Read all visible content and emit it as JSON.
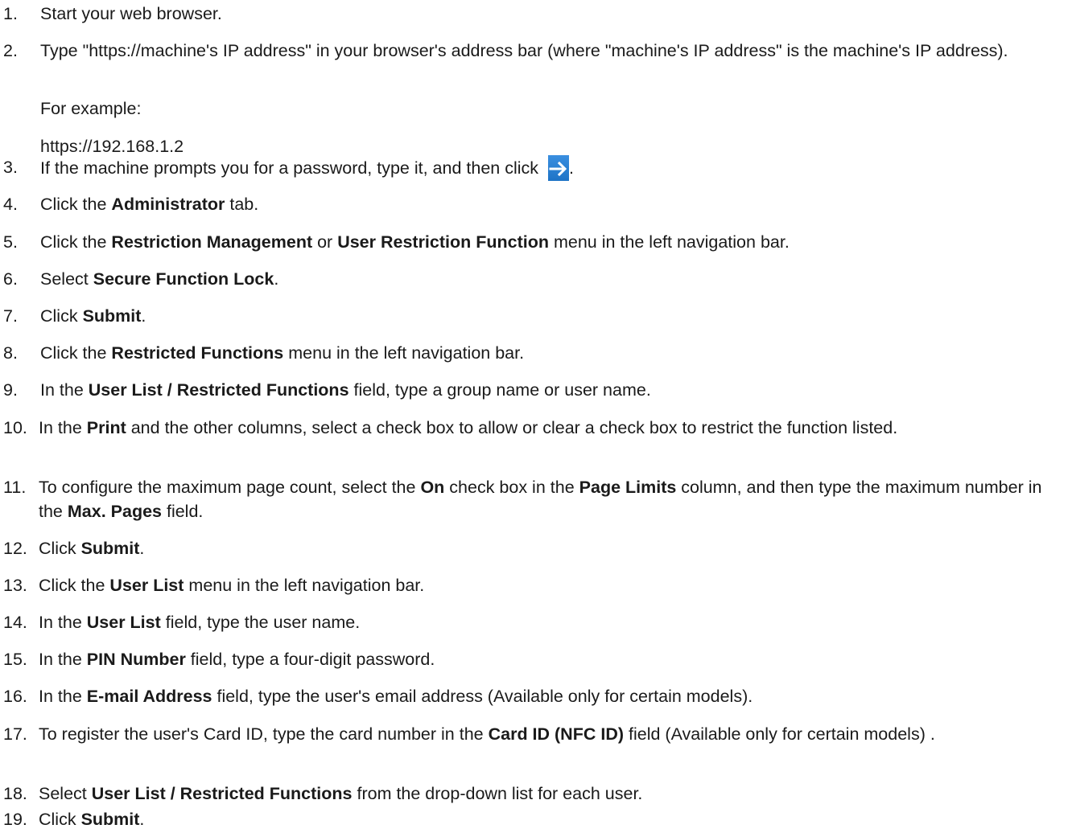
{
  "steps": [
    {
      "num": "1.",
      "parts": [
        {
          "t": "Start your web browser."
        }
      ]
    },
    {
      "num": "2.",
      "parts": [
        {
          "t": "Type \"https://machine's IP address\" in your browser's address bar (where \"machine's IP address\" is the machine's IP address)."
        }
      ]
    },
    {
      "num": "3.",
      "parts": [
        {
          "t": "If the machine prompts you for a password, type it, and then click "
        }
      ],
      "after_icon": "."
    },
    {
      "num": "4.",
      "parts": [
        {
          "t": "Click the "
        },
        {
          "b": "Administrator"
        },
        {
          "t": " tab."
        }
      ]
    },
    {
      "num": "5.",
      "parts": [
        {
          "t": "Click the "
        },
        {
          "b": "Restriction Management"
        },
        {
          "t": " or "
        },
        {
          "b": "User Restriction Function"
        },
        {
          "t": " menu in the left navigation bar."
        }
      ]
    },
    {
      "num": "6.",
      "parts": [
        {
          "t": "Select "
        },
        {
          "b": "Secure Function Lock"
        },
        {
          "t": "."
        }
      ]
    },
    {
      "num": "7.",
      "parts": [
        {
          "t": "Click "
        },
        {
          "b": "Submit"
        },
        {
          "t": "."
        }
      ]
    },
    {
      "num": "8.",
      "parts": [
        {
          "t": "Click the "
        },
        {
          "b": "Restricted Functions"
        },
        {
          "t": " menu in the left navigation bar."
        }
      ]
    },
    {
      "num": "9.",
      "parts": [
        {
          "t": "In the "
        },
        {
          "b": "User List / Restricted Functions"
        },
        {
          "t": " field, type a group name or user name."
        }
      ]
    },
    {
      "num": "10.",
      "parts": [
        {
          "t": "In the "
        },
        {
          "b": "Print"
        },
        {
          "t": " and the other columns, select a check box to allow or clear a check box to restrict the function listed."
        }
      ]
    },
    {
      "num": "11.",
      "parts": [
        {
          "t": "To configure the maximum page count, select the "
        },
        {
          "b": "On"
        },
        {
          "t": " check box in the "
        },
        {
          "b": "Page Limits"
        },
        {
          "t": " column, and then type the maximum number in the "
        },
        {
          "b": "Max. Pages"
        },
        {
          "t": " field."
        }
      ]
    },
    {
      "num": "12.",
      "parts": [
        {
          "t": "Click "
        },
        {
          "b": "Submit"
        },
        {
          "t": "."
        }
      ]
    },
    {
      "num": "13.",
      "parts": [
        {
          "t": "Click the "
        },
        {
          "b": "User List"
        },
        {
          "t": " menu in the left navigation bar."
        }
      ]
    },
    {
      "num": "14.",
      "parts": [
        {
          "t": "In the "
        },
        {
          "b": "User List"
        },
        {
          "t": " field, type the user name."
        }
      ]
    },
    {
      "num": "15.",
      "parts": [
        {
          "t": "In the "
        },
        {
          "b": "PIN Number"
        },
        {
          "t": " field, type a four-digit password."
        }
      ]
    },
    {
      "num": "16.",
      "parts": [
        {
          "t": "In the "
        },
        {
          "b": "E-mail Address"
        },
        {
          "t": " field, type the user's email address (Available only for certain models)."
        }
      ]
    },
    {
      "num": "17.",
      "parts": [
        {
          "t": "To register the user's Card ID, type the card number in the "
        },
        {
          "b": "Card ID (NFC ID)"
        },
        {
          "t": " field (Available only for certain models) ."
        }
      ]
    },
    {
      "num": "18.",
      "parts": [
        {
          "t": "Select "
        },
        {
          "b": "User List / Restricted Functions"
        },
        {
          "t": " from the drop-down list for each user."
        }
      ]
    },
    {
      "num": "19.",
      "parts": [
        {
          "t": "Click "
        },
        {
          "b": "Submit"
        },
        {
          "t": "."
        }
      ]
    }
  ],
  "example": {
    "label": "For example:",
    "url": "https://192.168.1.2"
  },
  "icons": {
    "go_arrow": "go-arrow-icon",
    "go_arrow_bg": "#1e73c6",
    "go_arrow_fg": "#ffffff"
  }
}
